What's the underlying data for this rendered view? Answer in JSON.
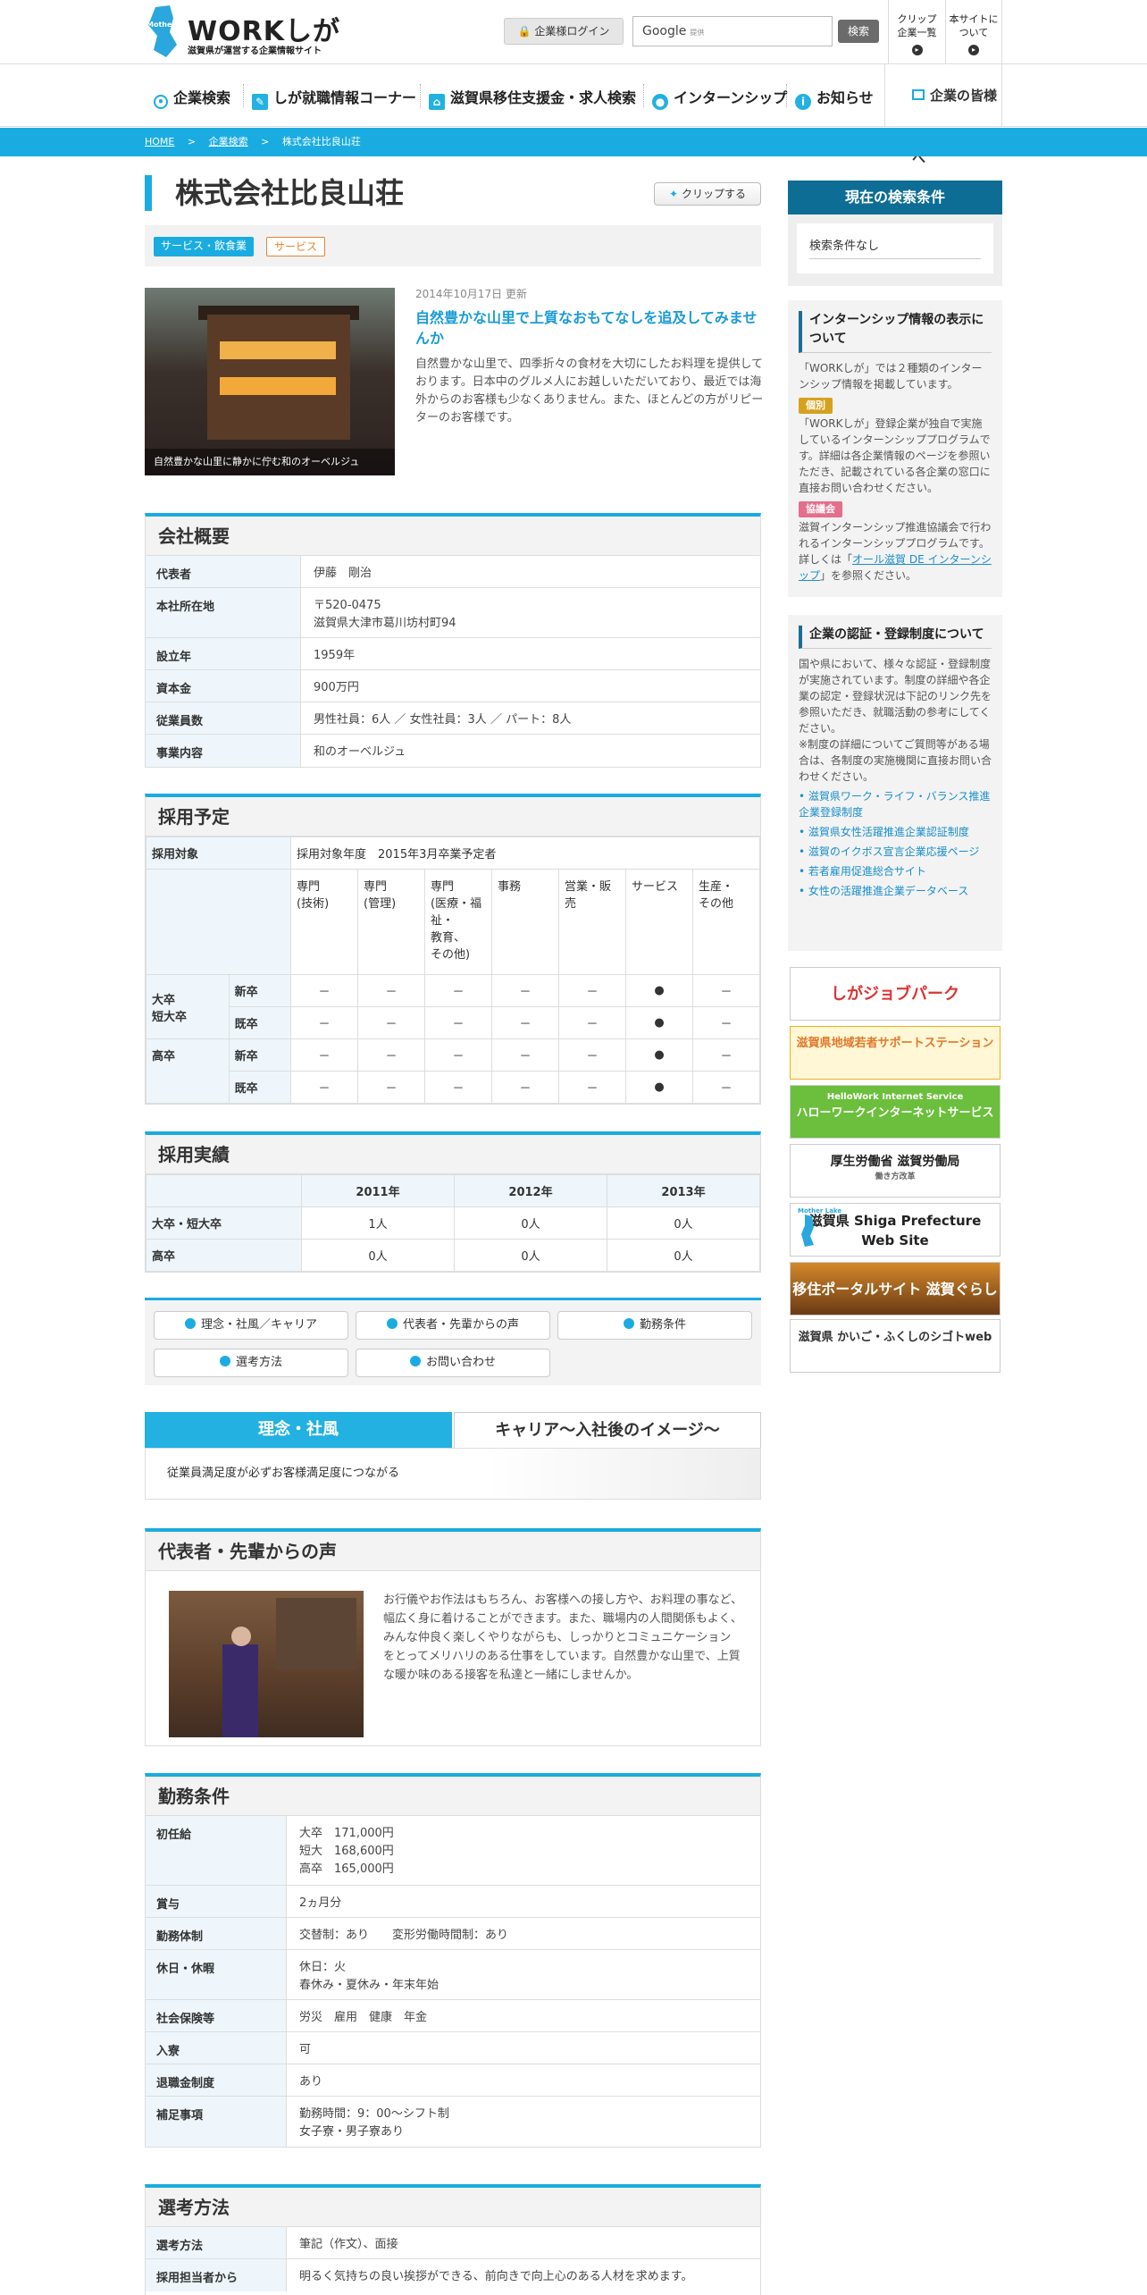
{
  "header": {
    "logo_text": "WORKしが",
    "logo_sub": "滋賀県が運営する企業情報サイト",
    "logo_mark": "Mother Lake",
    "login": "企業様ログイン",
    "search_placeholder": "Google",
    "search_powered": "提供",
    "search_button": "検索",
    "clip_list": "クリップ\n企業一覧",
    "about": "本サイトに\nついて"
  },
  "nav": {
    "items": [
      "企業検索",
      "しが就職情報コーナー",
      "滋賀県移住支援金・求人検索",
      "インターンシップ",
      "お知らせ"
    ],
    "corp": "企業の皆様へ"
  },
  "breadcrumb": [
    "HOME",
    "企業検索",
    "株式会社比良山荘"
  ],
  "company": {
    "name": "株式会社比良山荘",
    "clip": "クリップする",
    "tags": [
      "サービス・飲食業",
      "サービス"
    ],
    "updated": "2014年10月17日 更新",
    "headline": "自然豊かな山里で上質なおもてなしを追及してみませんか",
    "description": "自然豊かな山里で、四季折々の食材を大切にしたお料理を提供しております。日本中のグルメ人にお越しいただいており、最近では海外からのお客様も少なくありません。また、ほとんどの方がリピーターのお客様です。",
    "photo_caption": "自然豊かな山里に静かに佇む和のオーベルジュ"
  },
  "overview": {
    "title": "会社概要",
    "rows": [
      {
        "k": "代表者",
        "v": "伊藤　剛治"
      },
      {
        "k": "本社所在地",
        "v": "〒520-0475\n滋賀県大津市葛川坊村町94"
      },
      {
        "k": "設立年",
        "v": "1959年"
      },
      {
        "k": "資本金",
        "v": "900万円"
      },
      {
        "k": "従業員数",
        "v": "男性社員：6人 ／ 女性社員：3人 ／ パート：8人"
      },
      {
        "k": "事業内容",
        "v": "和のオーベルジュ"
      }
    ]
  },
  "plan": {
    "title": "採用予定",
    "target_label": "採用対象",
    "target_value": "採用対象年度　2015年3月卒業予定者",
    "columns": [
      "専門\n(技術)",
      "専門\n(管理)",
      "専門\n(医療・福祉・\n教育、\nその他)",
      "事務",
      "営業・販売",
      "サービス",
      "生産・\nその他"
    ],
    "groups": [
      {
        "name": "大卒\n短大卒",
        "rows": [
          {
            "sub": "新卒",
            "vals": [
              "－",
              "－",
              "－",
              "－",
              "－",
              "●",
              "－"
            ]
          },
          {
            "sub": "既卒",
            "vals": [
              "－",
              "－",
              "－",
              "－",
              "－",
              "●",
              "－"
            ]
          }
        ]
      },
      {
        "name": "高卒",
        "rows": [
          {
            "sub": "新卒",
            "vals": [
              "－",
              "－",
              "－",
              "－",
              "－",
              "●",
              "－"
            ]
          },
          {
            "sub": "既卒",
            "vals": [
              "－",
              "－",
              "－",
              "－",
              "－",
              "●",
              "－"
            ]
          }
        ]
      }
    ]
  },
  "results": {
    "title": "採用実績",
    "years": [
      "2011年",
      "2012年",
      "2013年"
    ],
    "rows": [
      {
        "k": "大卒・短大卒",
        "vals": [
          "1人",
          "0人",
          "0人"
        ]
      },
      {
        "k": "高卒",
        "vals": [
          "0人",
          "0人",
          "0人"
        ]
      }
    ]
  },
  "links": [
    "理念・社風／キャリア",
    "代表者・先輩からの声",
    "勤務条件",
    "選考方法",
    "お問い合わせ"
  ],
  "tabs": {
    "active": "理念・社風",
    "other": "キャリア～入社後のイメージ～",
    "body": "従業員満足度が必ずお客様満足度につながる"
  },
  "voice": {
    "title": "代表者・先輩からの声",
    "text": "お行儀やお作法はもちろん、お客様への接し方や、お料理の事など、幅広く身に着けることができます。また、職場内の人間関係もよく、みんな仲良く楽しくやりながらも、しっかりとコミュニケーションをとってメリハリのある仕事をしています。自然豊かな山里で、上質な暖か味のある接客を私達と一緒にしませんか。"
  },
  "conditions": {
    "title": "勤務条件",
    "rows": [
      {
        "k": "初任給",
        "v": "大卒　171,000円\n短大　168,600円\n高卒　165,000円"
      },
      {
        "k": "賞与",
        "v": "2ヵ月分"
      },
      {
        "k": "勤務体制",
        "v": "交替制：あり　　変形労働時間制：あり"
      },
      {
        "k": "休日・休暇",
        "v": "休日：火\n春休み・夏休み・年末年始"
      },
      {
        "k": "社会保険等",
        "v": "労災　雇用　健康　年金"
      },
      {
        "k": "入寮",
        "v": "可"
      },
      {
        "k": "退職金制度",
        "v": "あり"
      },
      {
        "k": "補足事項",
        "v": "勤務時間：9：00～シフト制\n女子寮・男子寮あり"
      }
    ]
  },
  "selection": {
    "title": "選考方法",
    "rows": [
      {
        "k": "選考方法",
        "v": "筆記（作文）、面接"
      },
      {
        "k": "採用担当者から",
        "v": "明るく気持ちの良い挨拶ができる、前向きで向上心のある人材を求めます。"
      }
    ]
  },
  "sidebar": {
    "cond_title": "現在の検索条件",
    "cond_value": "検索条件なし",
    "intern_title": "インターンシップ情報の表示について",
    "intern_intro": "「WORKしが」では２種類のインターンシップ情報を掲載しています。",
    "badge1": "個別",
    "badge1_text": "「WORKしが」登録企業が独自で実施しているインターンシッププログラムです。詳細は各企業情報のページを参照いただき、記載されている各企業の窓口に直接お問い合わせください。",
    "badge2": "協議会",
    "badge2_text_a": "滋賀インターンシップ推進協議会で行われるインターンシッププログラムです。詳しくは「",
    "badge2_link": "オール滋賀 DE インターンシップ",
    "badge2_text_b": "」を参照ください。",
    "cert_title": "企業の認証・登録制度について",
    "cert_text": "国や県において、様々な認証・登録制度が実施されています。制度の詳細や各企業の認定・登録状況は下記のリンク先を参照いただき、就職活動の参考にしてください。\n※制度の詳細についてご質問等がある場合は、各制度の実施機関に直接お問い合わせください。",
    "cert_links": [
      "滋賀県ワーク・ライフ・バランス推進企業登録制度",
      "滋賀県女性活躍推進企業認証制度",
      "滋賀のイクボス宣言企業応援ページ",
      "若者雇用促進総合サイト",
      "女性の活躍推進企業データベース"
    ],
    "banners": [
      "しがジョブパーク",
      "滋賀県地域若者サポートステーション",
      "ハローワークインターネットサービス",
      "厚生労働省 滋賀労働局",
      "滋賀県 Shiga Prefecture Web Site",
      "移住ポータルサイト 滋賀ぐらし",
      "滋賀県 かいご・ふくしのシゴトweb"
    ],
    "banner_sub": [
      "HelloWork Internet Service",
      "働き方改革",
      "Mother Lake"
    ]
  }
}
